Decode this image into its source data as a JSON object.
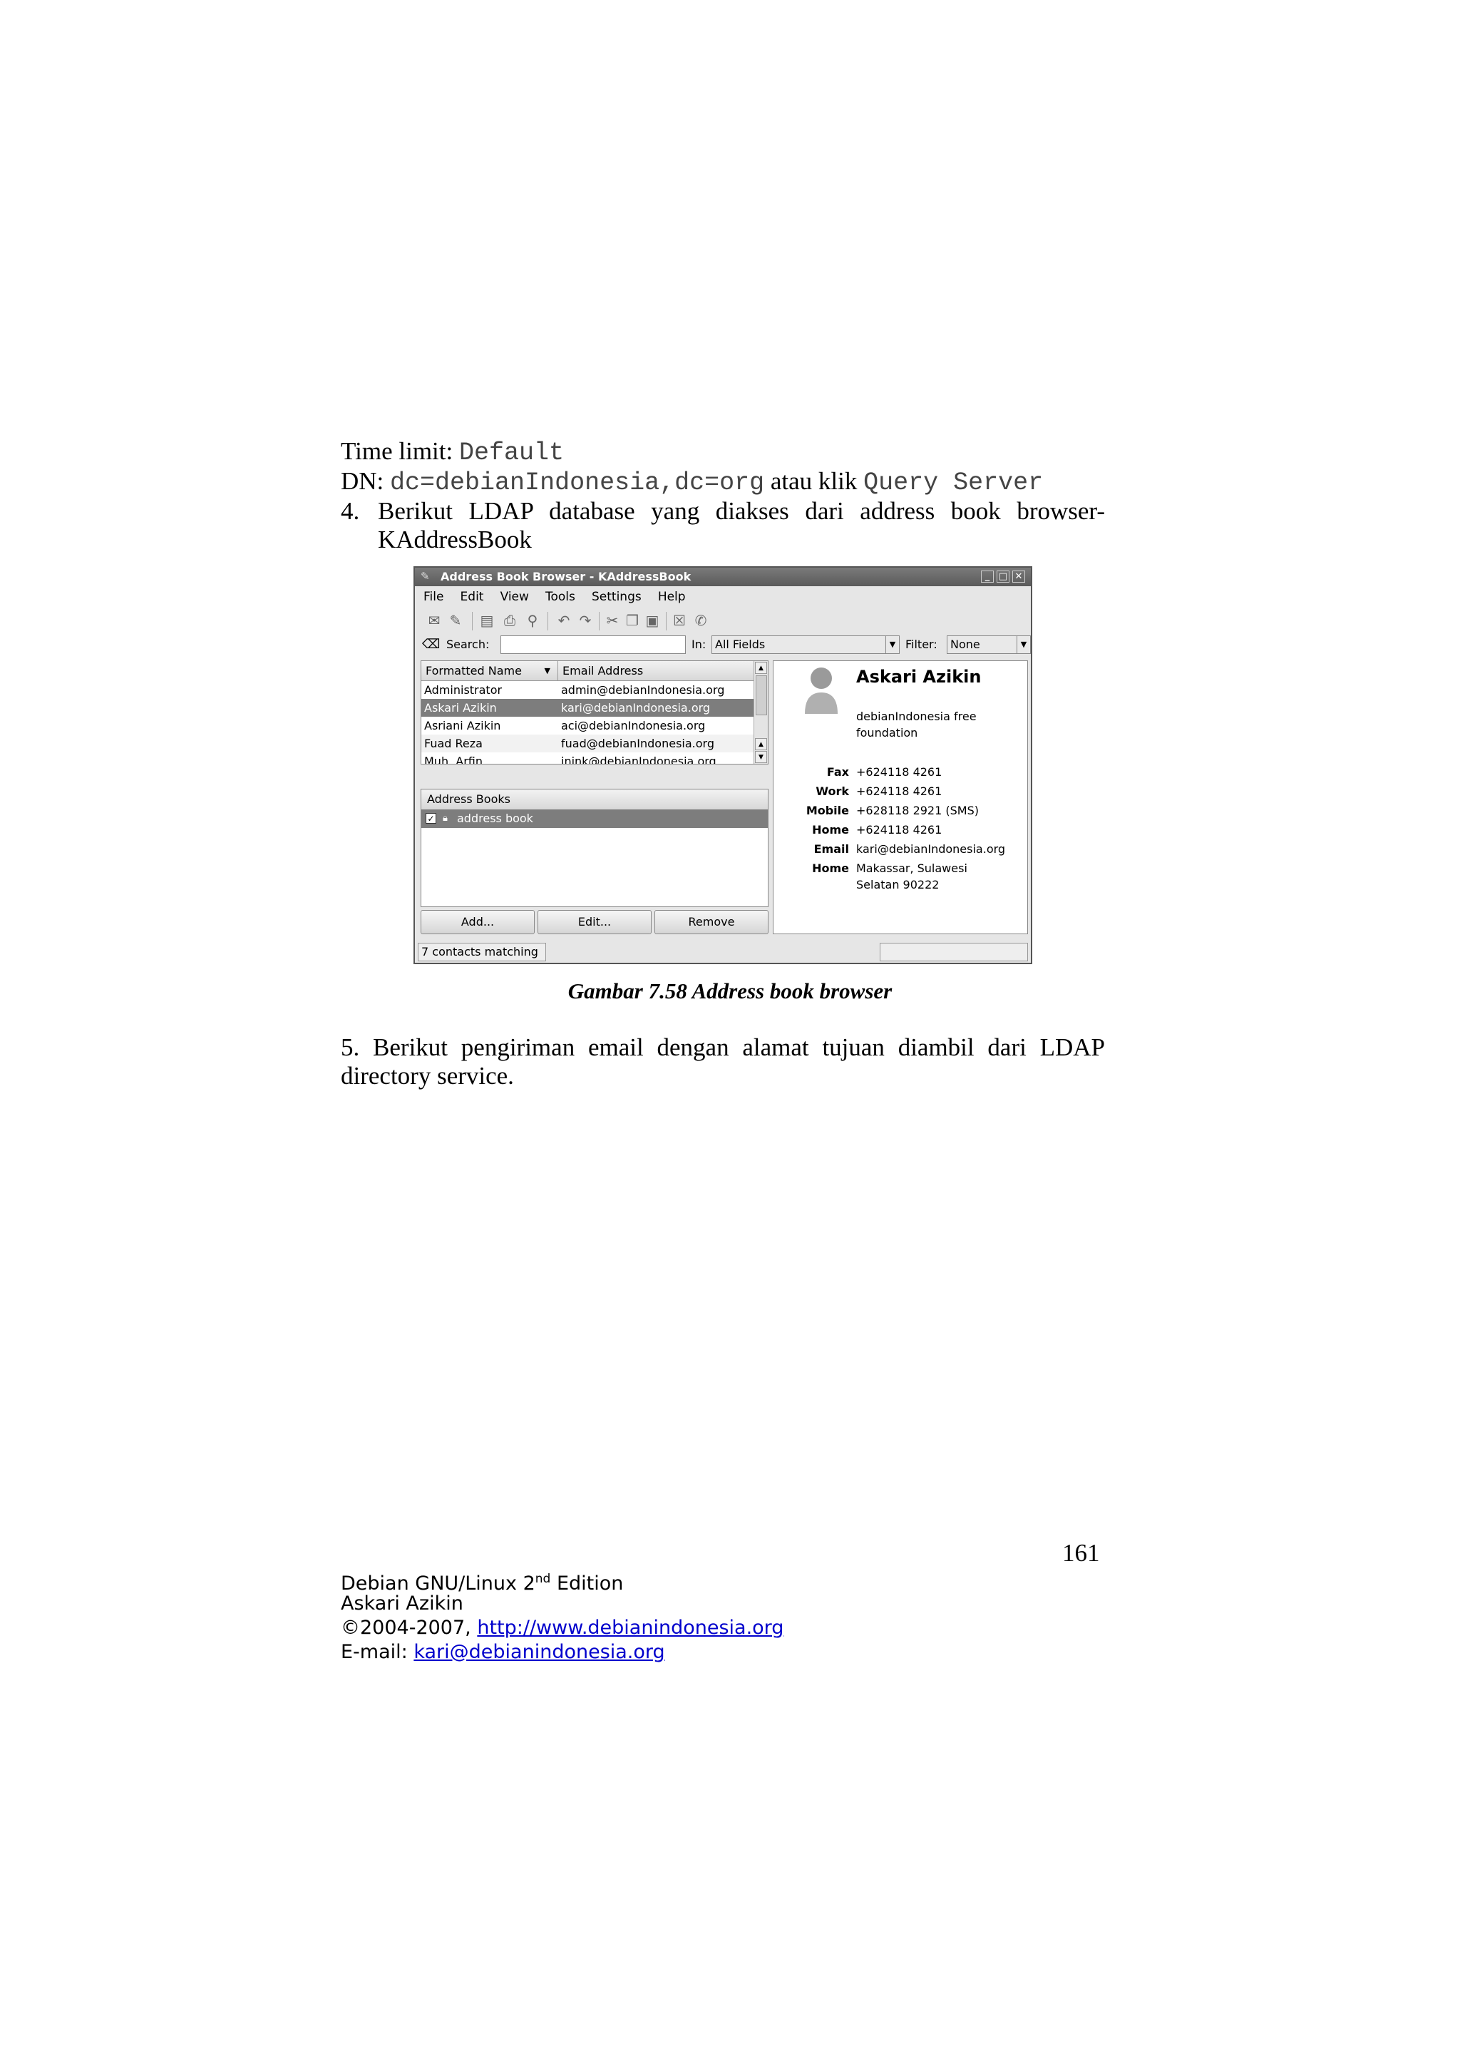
{
  "body": {
    "time_limit_label": "Time limit: ",
    "time_limit_value": "Default",
    "dn_label": "DN: ",
    "dn_value": "dc=debianIndonesia,dc=org",
    "dn_mid": " atau klik ",
    "query_server": "Query Server",
    "item4_number": "4.",
    "item4_words": [
      "Berikut",
      "LDAP",
      "database",
      "yang",
      "diakses",
      "dari",
      "address",
      "book",
      "browser-"
    ],
    "item4_line2": "KAddressBook",
    "caption": "Gambar 7.58 Address book browser",
    "item5_words": [
      "5.",
      "Berikut",
      "pengiriman",
      "email",
      "dengan",
      "alamat",
      "tujuan",
      "diambil",
      "dari",
      "LDAP"
    ],
    "item5_line2": "directory service."
  },
  "window": {
    "title": "Address Book Browser - KAddressBook",
    "menu": [
      "File",
      "Edit",
      "View",
      "Tools",
      "Settings",
      "Help"
    ],
    "search_label": "Search:",
    "search_value": "",
    "in_label": "In:",
    "in_value": "All Fields",
    "filter_label": "Filter:",
    "filter_value": "None",
    "columns": [
      "Formatted Name",
      "Email Address"
    ],
    "contacts": [
      {
        "name": "Administrator",
        "email": "admin@debianIndonesia.org"
      },
      {
        "name": "Askari Azikin",
        "email": "kari@debianIndonesia.org"
      },
      {
        "name": "Asriani Azikin",
        "email": "aci@debianIndonesia.org"
      },
      {
        "name": "Fuad Reza",
        "email": "fuad@debianIndonesia.org"
      },
      {
        "name": "Muh. Arfin",
        "email": "inink@debianIndonesia.org"
      }
    ],
    "address_books_header": "Address Books",
    "address_book_item": "address book",
    "buttons": {
      "add": "Add...",
      "edit": "Edit...",
      "remove": "Remove"
    },
    "status": "7 contacts matching",
    "detail": {
      "name": "Askari Azikin",
      "organization": "debianIndonesia free foundation",
      "fields": [
        {
          "label": "Fax",
          "value": "+624118  4261"
        },
        {
          "label": "Work",
          "value": "+624118  4261"
        },
        {
          "label": "Mobile",
          "value": "+628118  2921 (SMS)"
        },
        {
          "label": "Home",
          "value": "+624118  4261"
        },
        {
          "label": "Email",
          "value": "kari@debianIndonesia.org"
        },
        {
          "label": "Home",
          "value": "Makassar, Sulawesi"
        }
      ],
      "address_line2": "Selatan 90222"
    }
  },
  "page_number": "161",
  "footer": {
    "line1_pre": "Debian GNU/Linux 2",
    "line1_sup": "nd",
    "line1_post": " Edition",
    "author": "Askari Azikin",
    "copyright_pre": "©2004-2007, ",
    "url": "http://www.debianindonesia.org",
    "email_label": "E-mail: ",
    "email": "kari@debianindonesia.org"
  }
}
